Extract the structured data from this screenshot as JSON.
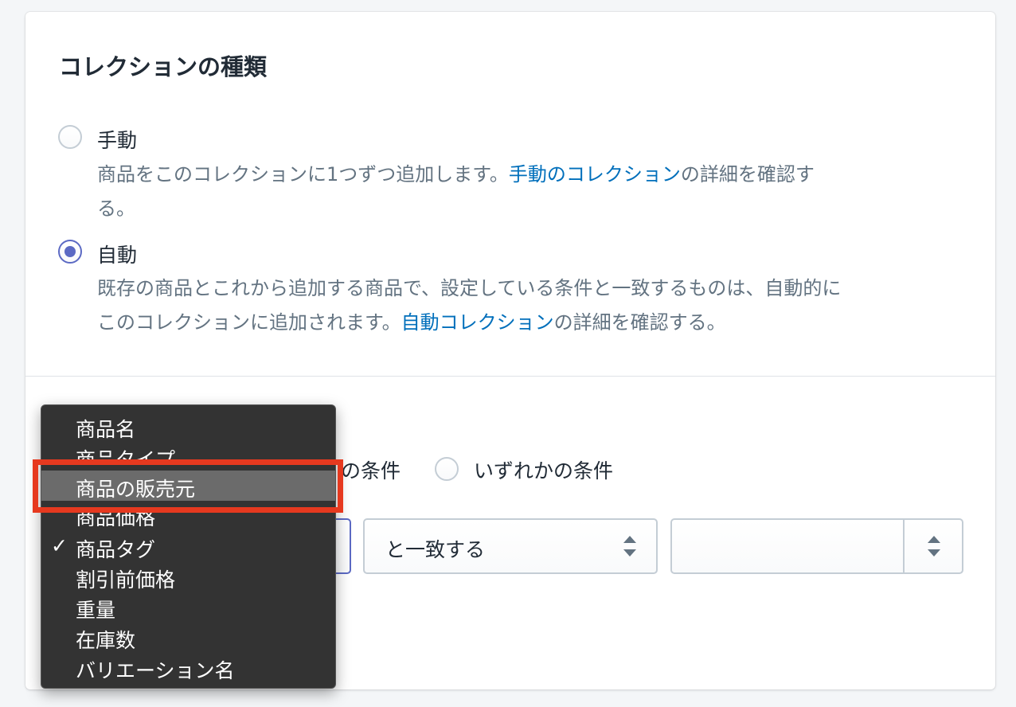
{
  "card": {
    "title": "コレクションの種類"
  },
  "collection_type": {
    "manual": {
      "label": "手動",
      "checked": false,
      "help_prefix": "商品をこのコレクションに1つずつ追加します。",
      "help_link": "手動のコレクション",
      "help_suffix": "の詳細を確認す",
      "help_wrap": "る。"
    },
    "automatic": {
      "label": "自動",
      "checked": true,
      "help_line1": "既存の商品とこれから追加する商品で、設定している条件と一致するものは、自動的に",
      "help_prefix": "このコレクションに追加されます。",
      "help_link": "自動コレクション",
      "help_suffix": "の詳細を確認する。"
    }
  },
  "conditions": {
    "all_label_partial": "の条件",
    "any_label": "いずれかの条件",
    "relation_select": "と一致する",
    "value_input": ""
  },
  "dropdown": {
    "items": [
      {
        "label": "商品名",
        "checked": false
      },
      {
        "label": "商品タイプ",
        "checked": false
      },
      {
        "label": "商品の販売元",
        "checked": false,
        "highlighted": true
      },
      {
        "label": "商品価格",
        "checked": false
      },
      {
        "label": "商品タグ",
        "checked": true
      },
      {
        "label": "割引前価格",
        "checked": false
      },
      {
        "label": "重量",
        "checked": false
      },
      {
        "label": "在庫数",
        "checked": false
      },
      {
        "label": "バリエーション名",
        "checked": false
      }
    ],
    "check_glyph": "✓"
  },
  "colors": {
    "accent": "#5c6ac4",
    "link": "#006fbb",
    "highlight_border": "#e6391f"
  }
}
